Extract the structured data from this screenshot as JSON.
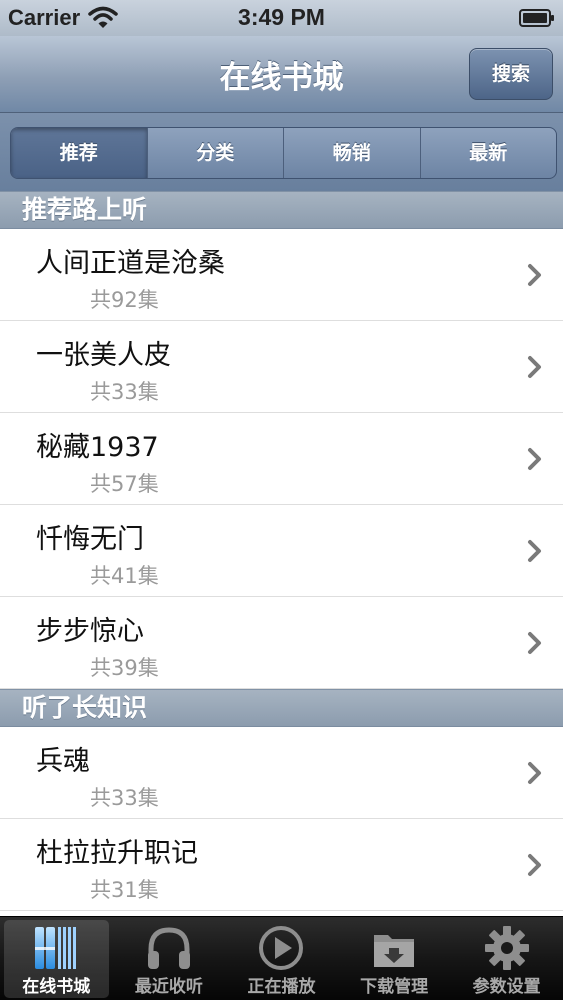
{
  "status_bar": {
    "carrier": "Carrier",
    "time": "3:49 PM"
  },
  "nav": {
    "title": "在线书城",
    "search_label": "搜索"
  },
  "segments": [
    {
      "label": "推荐",
      "selected": true
    },
    {
      "label": "分类",
      "selected": false
    },
    {
      "label": "畅销",
      "selected": false
    },
    {
      "label": "最新",
      "selected": false
    }
  ],
  "sections": [
    {
      "header": "推荐路上听",
      "items": [
        {
          "title": "人间正道是沧桑",
          "subtitle": "共92集"
        },
        {
          "title": "一张美人皮",
          "subtitle": "共33集"
        },
        {
          "title": "秘藏1937",
          "subtitle": "共57集"
        },
        {
          "title": "忏悔无门",
          "subtitle": "共41集"
        },
        {
          "title": "步步惊心",
          "subtitle": "共39集"
        }
      ]
    },
    {
      "header": "听了长知识",
      "items": [
        {
          "title": "兵魂",
          "subtitle": "共33集"
        },
        {
          "title": "杜拉拉升职记",
          "subtitle": "共31集"
        }
      ]
    }
  ],
  "tabs": [
    {
      "label": "在线书城",
      "icon": "bookshelf-icon",
      "selected": true
    },
    {
      "label": "最近收听",
      "icon": "headphones-icon",
      "selected": false
    },
    {
      "label": "正在播放",
      "icon": "play-circle-icon",
      "selected": false
    },
    {
      "label": "下载管理",
      "icon": "folder-download-icon",
      "selected": false
    },
    {
      "label": "参数设置",
      "icon": "gear-icon",
      "selected": false
    }
  ],
  "colors": {
    "nav_gradient_top": "#b9c6d6",
    "nav_gradient_bottom": "#7088a6",
    "section_header": "#8c9cae",
    "subtitle_gray": "#9a9a9a",
    "tab_bar": "#161616"
  }
}
